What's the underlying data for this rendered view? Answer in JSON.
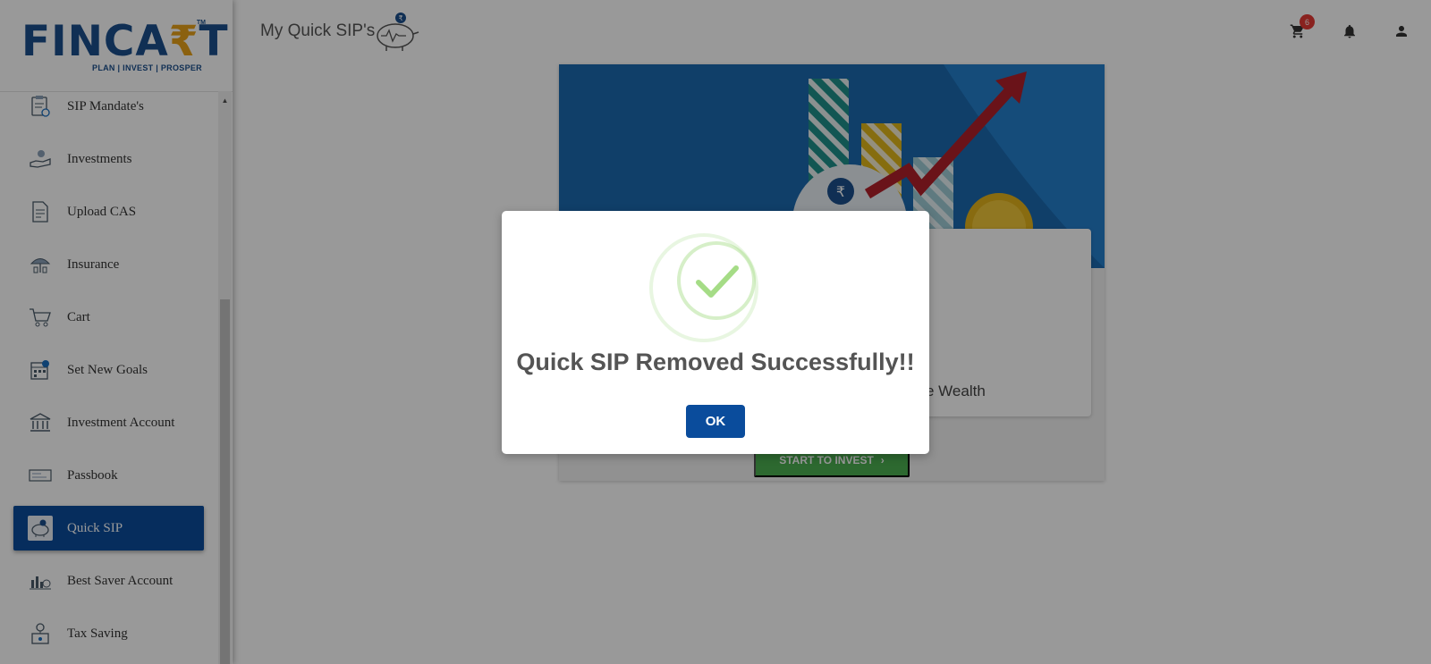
{
  "brand": {
    "logo_main": "FINCA",
    "logo_accent": "₹",
    "logo_end": "T",
    "logo_tm": "TM",
    "logo_tagline": "PLAN | INVEST | PROSPER"
  },
  "sidebar": {
    "items": [
      {
        "label": "SIP Mandate's",
        "icon": "clipboard-icon"
      },
      {
        "label": "Investments",
        "icon": "hand-coin-icon"
      },
      {
        "label": "Upload CAS",
        "icon": "document-icon"
      },
      {
        "label": "Insurance",
        "icon": "umbrella-icon"
      },
      {
        "label": "Cart",
        "icon": "cart-icon"
      },
      {
        "label": "Set New Goals",
        "icon": "calendar-goal-icon"
      },
      {
        "label": "Investment Account",
        "icon": "bank-icon"
      },
      {
        "label": "Passbook",
        "icon": "passbook-icon"
      },
      {
        "label": "Quick SIP",
        "icon": "piggy-bank-icon",
        "active": true
      },
      {
        "label": "Best Saver Account",
        "icon": "savings-icon"
      },
      {
        "label": "Tax Saving",
        "icon": "tax-icon"
      }
    ]
  },
  "header": {
    "title": "My Quick SIP's",
    "cart_count": "6"
  },
  "card": {
    "partial_text": "e Wealth",
    "invest_button": "START TO INVEST"
  },
  "modal": {
    "title": "Quick SIP Removed Successfully!!",
    "ok_label": "OK"
  },
  "colors": {
    "primary": "#0a4c9c",
    "success": "#a5dc86",
    "invest_green": "#4caf50",
    "badge_red": "#e53935"
  }
}
